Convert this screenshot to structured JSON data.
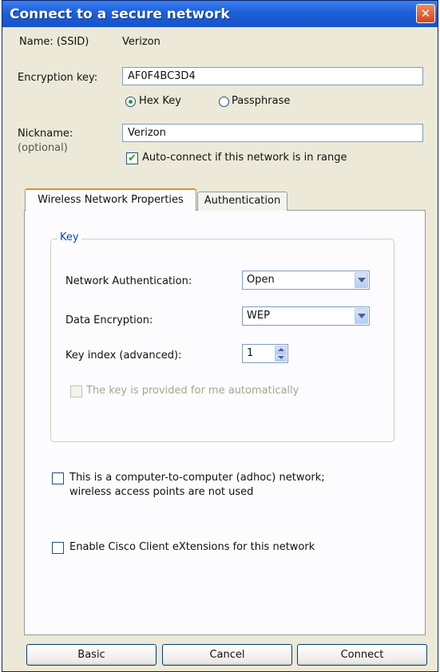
{
  "window": {
    "title": "Connect to a secure network",
    "close_icon": "close-icon (×)"
  },
  "fields": {
    "name_label": "Name:  (SSID)",
    "name_value": "Verizon",
    "encryption_label": "Encryption key:",
    "encryption_value": "AF0F4BC3D4",
    "hex_key_label": "Hex Key",
    "hex_key_selected": true,
    "passphrase_label": "Passphrase",
    "nickname_label": "Nickname:",
    "nickname_sub": "(optional)",
    "nickname_value": "Verizon",
    "auto_connect_label": "Auto-connect if this network is in range",
    "auto_connect_checked": true
  },
  "tabs": [
    {
      "label": "Wireless Network Properties",
      "active": true
    },
    {
      "label": "Authentication",
      "active": false
    }
  ],
  "key_group": {
    "title": "Key",
    "network_auth_label": "Network Authentication:",
    "network_auth_value": "Open",
    "data_encryption_label": "Data Encryption:",
    "data_encryption_value": "WEP",
    "key_index_label": "Key index (advanced):",
    "key_index_value": "1",
    "auto_key_label": "The key is provided for me automatically",
    "auto_key_enabled": false
  },
  "options": {
    "adhoc_line1": "This is a computer-to-computer (adhoc) network;",
    "adhoc_line2": "wireless access points are not used",
    "adhoc_checked": false,
    "cisco_label": "Enable Cisco Client eXtensions for this network",
    "cisco_checked": false
  },
  "buttons": {
    "basic": "Basic",
    "cancel": "Cancel",
    "connect": "Connect"
  },
  "colors": {
    "titlebar": "#1e5fd8",
    "dialog_bg": "#ece9d8",
    "close_button": "#d6431c",
    "active_tab_accent": "#e68b2c"
  }
}
